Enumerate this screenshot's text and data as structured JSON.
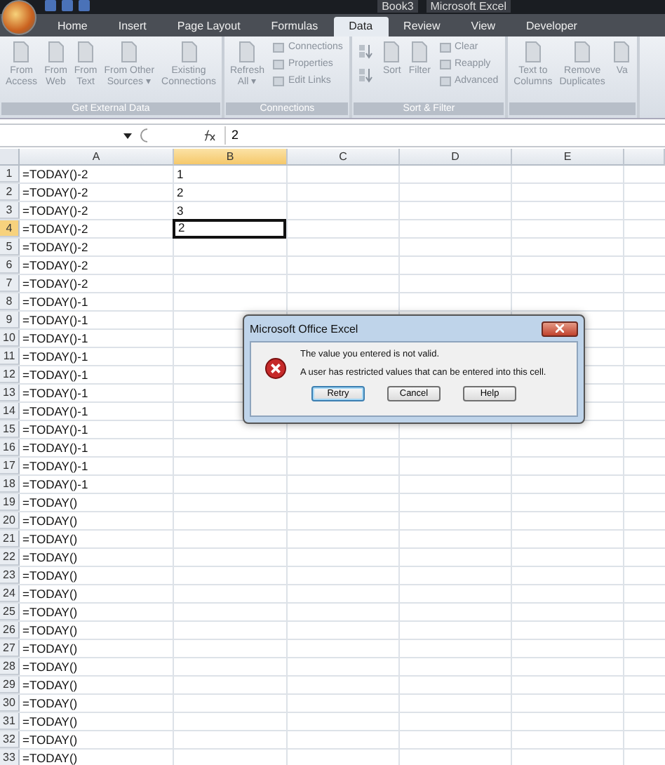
{
  "title_bar": {
    "document": "Book3",
    "app": "Microsoft Excel"
  },
  "tabs": [
    {
      "label": "Home",
      "selected": false
    },
    {
      "label": "Insert",
      "selected": false
    },
    {
      "label": "Page Layout",
      "selected": false
    },
    {
      "label": "Formulas",
      "selected": false
    },
    {
      "label": "Data",
      "selected": true
    },
    {
      "label": "Review",
      "selected": false
    },
    {
      "label": "View",
      "selected": false
    },
    {
      "label": "Developer",
      "selected": false
    }
  ],
  "ribbon_groups": [
    {
      "label": "Get External Data",
      "items": [
        {
          "kind": "large",
          "lines": [
            "From",
            "Access"
          ]
        },
        {
          "kind": "large",
          "lines": [
            "From",
            "Web"
          ]
        },
        {
          "kind": "large",
          "lines": [
            "From",
            "Text"
          ]
        },
        {
          "kind": "large",
          "lines": [
            "From Other",
            "Sources ▾"
          ]
        },
        {
          "kind": "large",
          "lines": [
            "Existing",
            "Connections"
          ]
        }
      ]
    },
    {
      "label": "Connections",
      "items": [
        {
          "kind": "large",
          "lines": [
            "Refresh",
            "All ▾"
          ]
        },
        {
          "kind": "stack",
          "labels": [
            "Connections",
            "Properties",
            "Edit Links"
          ]
        }
      ]
    },
    {
      "label": "Sort & Filter",
      "items": [
        {
          "kind": "sortpair"
        },
        {
          "kind": "large",
          "lines": [
            "Sort"
          ]
        },
        {
          "kind": "large",
          "lines": [
            "Filter"
          ]
        },
        {
          "kind": "stack",
          "labels": [
            "Clear",
            "Reapply",
            "Advanced"
          ]
        }
      ]
    },
    {
      "items": [
        {
          "kind": "large",
          "lines": [
            "Text to",
            "Columns"
          ]
        },
        {
          "kind": "large",
          "lines": [
            "Remove",
            "Duplicates"
          ]
        },
        {
          "kind": "large",
          "lines": [
            "Va"
          ]
        }
      ]
    }
  ],
  "formula_bar": {
    "value": "2"
  },
  "columns": [
    {
      "label": "A",
      "selected": false
    },
    {
      "label": "B",
      "selected": true
    },
    {
      "label": "C",
      "selected": false
    },
    {
      "label": "D",
      "selected": false
    },
    {
      "label": "E",
      "selected": false
    }
  ],
  "rows": [
    {
      "header": "1",
      "selected": false,
      "cells": [
        "=TODAY()-2",
        "1"
      ]
    },
    {
      "header": "2",
      "selected": false,
      "cells": [
        "=TODAY()-2",
        "2"
      ]
    },
    {
      "header": "3",
      "selected": false,
      "cells": [
        "=TODAY()-2",
        "3"
      ]
    },
    {
      "header": "4",
      "selected": true,
      "cells": [
        "=TODAY()-2",
        "2"
      ]
    },
    {
      "header": "5",
      "selected": false,
      "cells": [
        "=TODAY()-2"
      ]
    },
    {
      "header": "6",
      "selected": false,
      "cells": [
        "=TODAY()-2"
      ]
    },
    {
      "header": "7",
      "selected": false,
      "cells": [
        "=TODAY()-2"
      ]
    },
    {
      "header": "8",
      "selected": false,
      "cells": [
        "=TODAY()-1"
      ]
    },
    {
      "header": "9",
      "selected": false,
      "cells": [
        "=TODAY()-1"
      ]
    },
    {
      "header": "10",
      "selected": false,
      "cells": [
        "=TODAY()-1"
      ]
    },
    {
      "header": "11",
      "selected": false,
      "cells": [
        "=TODAY()-1"
      ]
    },
    {
      "header": "12",
      "selected": false,
      "cells": [
        "=TODAY()-1"
      ]
    },
    {
      "header": "13",
      "selected": false,
      "cells": [
        "=TODAY()-1"
      ]
    },
    {
      "header": "14",
      "selected": false,
      "cells": [
        "=TODAY()-1"
      ]
    },
    {
      "header": "15",
      "selected": false,
      "cells": [
        "=TODAY()-1"
      ]
    },
    {
      "header": "16",
      "selected": false,
      "cells": [
        "=TODAY()-1"
      ]
    },
    {
      "header": "17",
      "selected": false,
      "cells": [
        "=TODAY()-1"
      ]
    },
    {
      "header": "18",
      "selected": false,
      "cells": [
        "=TODAY()-1"
      ]
    },
    {
      "header": "19",
      "selected": false,
      "cells": [
        "=TODAY()"
      ]
    },
    {
      "header": "20",
      "selected": false,
      "cells": [
        "=TODAY()"
      ]
    },
    {
      "header": "21",
      "selected": false,
      "cells": [
        "=TODAY()"
      ]
    },
    {
      "header": "22",
      "selected": false,
      "cells": [
        "=TODAY()"
      ]
    },
    {
      "header": "23",
      "selected": false,
      "cells": [
        "=TODAY()"
      ]
    },
    {
      "header": "24",
      "selected": false,
      "cells": [
        "=TODAY()"
      ]
    },
    {
      "header": "25",
      "selected": false,
      "cells": [
        "=TODAY()"
      ]
    },
    {
      "header": "26",
      "selected": false,
      "cells": [
        "=TODAY()"
      ]
    },
    {
      "header": "27",
      "selected": false,
      "cells": [
        "=TODAY()"
      ]
    },
    {
      "header": "28",
      "selected": false,
      "cells": [
        "=TODAY()"
      ]
    },
    {
      "header": "29",
      "selected": false,
      "cells": [
        "=TODAY()"
      ]
    },
    {
      "header": "30",
      "selected": false,
      "cells": [
        "=TODAY()"
      ]
    },
    {
      "header": "31",
      "selected": false,
      "cells": [
        "=TODAY()"
      ]
    },
    {
      "header": "32",
      "selected": false,
      "cells": [
        "=TODAY()"
      ]
    },
    {
      "header": "33",
      "selected": false,
      "cells": [
        "=TODAY()"
      ]
    }
  ],
  "dialog": {
    "title": "Microsoft Office Excel",
    "messages": [
      "The value you entered is not valid.",
      "A user has restricted values that can be entered into this cell."
    ],
    "buttons": [
      {
        "label": "Retry",
        "default": true
      },
      {
        "label": "Cancel",
        "default": false
      },
      {
        "label": "Help",
        "default": false
      }
    ]
  }
}
